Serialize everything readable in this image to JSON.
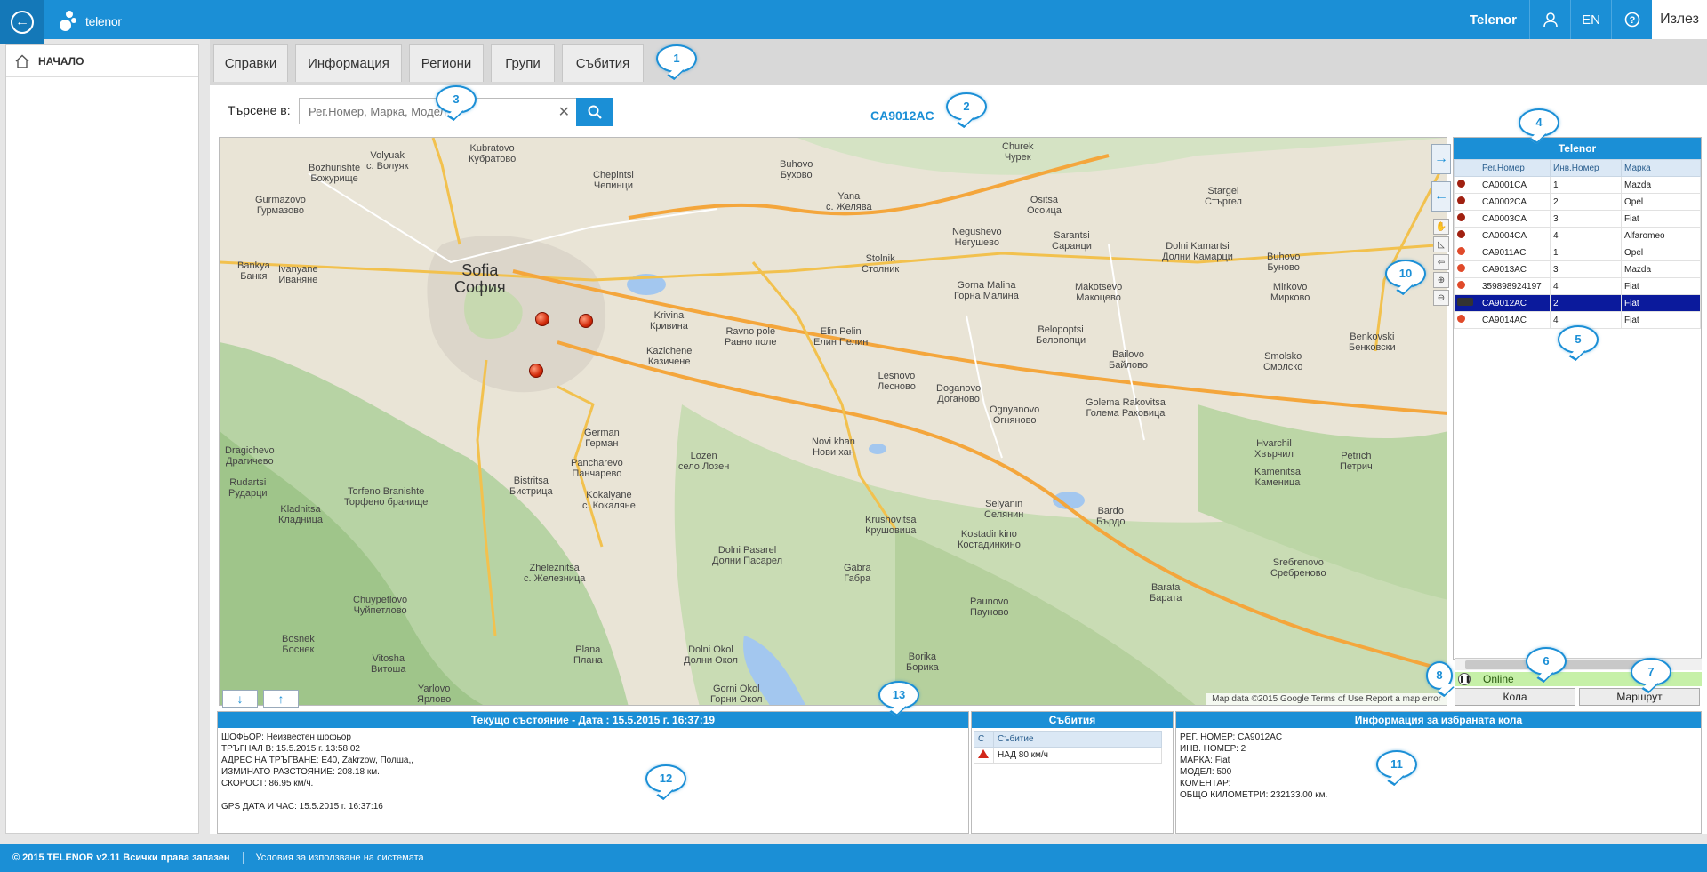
{
  "header": {
    "logo_text": "telenor",
    "user": "Telenor",
    "language": "EN",
    "exit_label": "Излез"
  },
  "sidebar": {
    "items": [
      {
        "label": "НАЧАЛО",
        "icon": "home-icon"
      }
    ]
  },
  "tabs": [
    {
      "label": "Справки"
    },
    {
      "label": "Информация"
    },
    {
      "label": "Региони"
    },
    {
      "label": "Групи"
    },
    {
      "label": "Събития"
    }
  ],
  "search": {
    "label": "Търсене в:",
    "placeholder": "Рег.Номер, Марка, Модел",
    "value": ""
  },
  "vehicle_title": "CA9012AC",
  "map": {
    "cities": [
      {
        "name": "Kubratovo\nКубратово"
      },
      {
        "name": "Chepintsi\nЧепинци"
      },
      {
        "name": "Buhovo\nБухово"
      },
      {
        "name": "Churek\nЧурек"
      },
      {
        "name": "Bozhurishte\nБожурище"
      },
      {
        "name": "Volyuak\nс. Волуяк"
      },
      {
        "name": "Yana\nс. Желява"
      },
      {
        "name": "Ositsa\nОсоица"
      },
      {
        "name": "Stargel\nСтъргел"
      },
      {
        "name": "Gurmazovo\nГурмазово"
      },
      {
        "name": "Negushevo\nНегушево"
      },
      {
        "name": "Sarantsi\nСаранци"
      },
      {
        "name": "Dolni Kamartsi\nДолни Камарци"
      },
      {
        "name": "Buhovo\nБуново"
      },
      {
        "name": "Bankya\nБанкя"
      },
      {
        "name": "Ivanyane\nИваняне"
      },
      {
        "name": "Sofia\nСофия"
      },
      {
        "name": "Stolnik\nСтолник"
      },
      {
        "name": "Gorna Malina\nГорна Малина"
      },
      {
        "name": "Makotsevo\nМакоцево"
      },
      {
        "name": "Mirkovo\nМирково"
      },
      {
        "name": "Krivina\nКривина"
      },
      {
        "name": "Ravno pole\nРавно поле"
      },
      {
        "name": "Elin Pelin\nЕлин Пелин"
      },
      {
        "name": "Belopoptsi\nБелопопци"
      },
      {
        "name": "Kazichene\nКазичене"
      },
      {
        "name": "Lesnovo\nЛесново"
      },
      {
        "name": "Doganovo\nДоганово"
      },
      {
        "name": "Bailovo\nБайлово"
      },
      {
        "name": "Smolsko\nСмолско"
      },
      {
        "name": "Benkovski\nБенковски"
      },
      {
        "name": "Ognyanovo\nОгняново"
      },
      {
        "name": "Golema Rakovitsa\nГолема Раковица"
      },
      {
        "name": "German\nГерман"
      },
      {
        "name": "Novi khan\nНови хан"
      },
      {
        "name": "Dragichevo\nДрагичево"
      },
      {
        "name": "Lozen\nсело Лозен"
      },
      {
        "name": "Pancharevo\nПанчарево"
      },
      {
        "name": "Hvarchil\nХвърчил"
      },
      {
        "name": "Petrich\nПетрич"
      },
      {
        "name": "Kamenitsa\nКаменица"
      },
      {
        "name": "Rudartsi\nРударци"
      },
      {
        "name": "Bistritsa\nБистрица"
      },
      {
        "name": "Kokalyane\nс. Кокаляне"
      },
      {
        "name": "Torfeno Branishte\nТорфено бранище"
      },
      {
        "name": "Bardo\nБърдо"
      },
      {
        "name": "Selyanin\nСелянин"
      },
      {
        "name": "Kladnitsa\nКладница"
      },
      {
        "name": "Krushovitsa\nКрушовица"
      },
      {
        "name": "Kostadinkino\nКостадинкино"
      },
      {
        "name": "Zheleznitsa\nс. Железница"
      },
      {
        "name": "Dolni Pasarel\nДолни Пасарел"
      },
      {
        "name": "Gabra\nГабра"
      },
      {
        "name": "Sreбrenovo\nСребреново"
      },
      {
        "name": "Barata\nБарата"
      },
      {
        "name": "Chuypetlovo\nЧуйпетлово"
      },
      {
        "name": "Paunovo\nПауново"
      },
      {
        "name": "Bosnek\nБоснек"
      },
      {
        "name": "Vitosha\nВитоша"
      },
      {
        "name": "Plana\nПлана"
      },
      {
        "name": "Dolni Okol\nДолни Окол"
      },
      {
        "name": "Borika\nБорика"
      },
      {
        "name": "Yarlovo\nЯрлово"
      },
      {
        "name": "Gorni Okol\nГорни Окол"
      }
    ],
    "attribution": "Map data ©2015 Google   Terms of Use   Report a map error"
  },
  "vehicles": {
    "title": "Telenor",
    "columns": [
      "Рег.Номер",
      "Инв.Номер",
      "Марка"
    ],
    "rows": [
      {
        "reg": "CA0001CA",
        "inv": "1",
        "make": "Mazda",
        "status": "dark"
      },
      {
        "reg": "CA0002CA",
        "inv": "2",
        "make": "Opel",
        "status": "dark"
      },
      {
        "reg": "CA0003CA",
        "inv": "3",
        "make": "Fiat",
        "status": "dark"
      },
      {
        "reg": "CA0004CA",
        "inv": "4",
        "make": "Alfaromeo",
        "status": "dark"
      },
      {
        "reg": "CA9011AC",
        "inv": "1",
        "make": "Opel",
        "status": "light"
      },
      {
        "reg": "CA9013AC",
        "inv": "3",
        "make": "Mazda",
        "status": "light"
      },
      {
        "reg": "359898924197",
        "inv": "4",
        "make": "Fiat",
        "status": "light"
      },
      {
        "reg": "CA9012AC",
        "inv": "2",
        "make": "Fiat",
        "status": "car",
        "selected": true
      },
      {
        "reg": "CA9014AC",
        "inv": "4",
        "make": "Fiat",
        "status": "light"
      }
    ],
    "online_label": "Online",
    "car_button": "Кола",
    "route_button": "Маршрут"
  },
  "status_panel": {
    "title": "Текущо състояние - Дата : 15.5.2015 г. 16:37:19",
    "driver_label": "ШОФЬОР:",
    "driver": "Неизвестен шофьор",
    "departed_label": "ТРЪГНАЛ В:",
    "departed": "15.5.2015 г. 13:58:02",
    "address_label": "АДРЕС НА ТРЪГВАНЕ:",
    "address": "E40, Zakrzow, Полша,,",
    "distance_label": "ИЗМИНАТО РАЗСТОЯНИЕ:",
    "distance": "208.18 км.",
    "speed_label": "СКОРОСТ:",
    "speed": "86.95 км/ч.",
    "gps_label": "GPS ДАТА И ЧАС:",
    "gps": "15.5.2015 г. 16:37:16"
  },
  "events_panel": {
    "title": "Събития",
    "columns": [
      "С",
      "Събитие"
    ],
    "rows": [
      {
        "event": "НАД 80 км/ч"
      }
    ]
  },
  "info_panel": {
    "title": "Информация за избраната кола",
    "reg_label": "РЕГ. НОМЕР:",
    "reg": "CA9012AC",
    "inv_label": "ИНВ. НОМЕР:",
    "inv": "2",
    "make_label": "МАРКА:",
    "make": "Fiat",
    "model_label": "МОДЕЛ:",
    "model": "500",
    "comment_label": "КОМЕНТАР:",
    "comment": "",
    "km_label": "ОБЩО КИЛОМЕТРИ:",
    "km": "232133.00 км."
  },
  "callouts": [
    "1",
    "2",
    "3",
    "4",
    "5",
    "6",
    "7",
    "8",
    "10",
    "11",
    "12",
    "13"
  ],
  "footer": {
    "copyright": "© 2015 TELENOR v2.11 Всички права запазен",
    "terms": "Условия за използване на системата"
  },
  "colors": {
    "brand": "#1b8fd6",
    "selected_row": "#0b1a9c",
    "online": "#c6f0a8"
  }
}
